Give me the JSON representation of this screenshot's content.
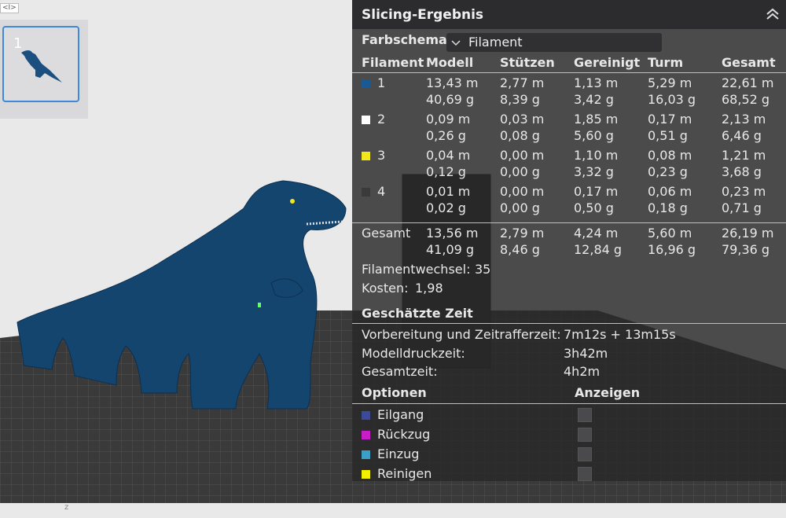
{
  "corner_tag": "<I>",
  "plate": {
    "number": "1"
  },
  "axis_label": "z",
  "panel": {
    "title": "Slicing-Ergebnis",
    "color_scheme": {
      "label": "Farbschema",
      "value": "Filament"
    },
    "table": {
      "headers": [
        "Filament",
        "Modell",
        "Stützen",
        "Gereinigt",
        "Turm",
        "Gesamt"
      ],
      "rows": [
        {
          "id": "1",
          "color": "#1a5a94",
          "m": [
            "13,43 m",
            "2,77 m",
            "1,13 m",
            "5,29 m",
            "22,61 m"
          ],
          "g": [
            "40,69 g",
            "8,39 g",
            "3,42 g",
            "16,03 g",
            "68,52 g"
          ]
        },
        {
          "id": "2",
          "color": "#ffffff",
          "m": [
            "0,09 m",
            "0,03 m",
            "1,85 m",
            "0,17 m",
            "2,13 m"
          ],
          "g": [
            "0,26 g",
            "0,08 g",
            "5,60 g",
            "0,51 g",
            "6,46 g"
          ]
        },
        {
          "id": "3",
          "color": "#f0e81a",
          "m": [
            "0,04 m",
            "0,00 m",
            "1,10 m",
            "0,08 m",
            "1,21 m"
          ],
          "g": [
            "0,12 g",
            "0,00 g",
            "3,32 g",
            "0,23 g",
            "3,68 g"
          ]
        },
        {
          "id": "4",
          "color": "#3a3a3a",
          "m": [
            "0,01 m",
            "0,00 m",
            "0,17 m",
            "0,06 m",
            "0,23 m"
          ],
          "g": [
            "0,02 g",
            "0,00 g",
            "0,50 g",
            "0,18 g",
            "0,71 g"
          ]
        }
      ],
      "total": {
        "label": "Gesamt",
        "m": [
          "13,56 m",
          "2,79 m",
          "4,24 m",
          "5,60 m",
          "26,19 m"
        ],
        "g": [
          "41,09 g",
          "8,46 g",
          "12,84 g",
          "16,96 g",
          "79,36 g"
        ]
      }
    },
    "filament_changes": {
      "label": "Filamentwechsel:",
      "value": "35"
    },
    "cost": {
      "label": "Kosten:",
      "value": "1,98"
    },
    "time": {
      "title": "Geschätzte Zeit",
      "prep_label": "Vorbereitung und Zeitrafferzeit:",
      "prep_value": "7m12s + 13m15s",
      "model_label": "Modelldruckzeit:",
      "model_value": "3h42m",
      "total_label": "Gesamtzeit:",
      "total_value": "4h2m"
    },
    "options": {
      "title": "Optionen",
      "display_title": "Anzeigen",
      "items": [
        {
          "label": "Eilgang",
          "color": "#3c4a9a"
        },
        {
          "label": "Rückzug",
          "color": "#c81ec8"
        },
        {
          "label": "Einzug",
          "color": "#3aa0c8"
        },
        {
          "label": "Reinigen",
          "color": "#f0f000"
        }
      ]
    }
  },
  "colors": {
    "panel_bg": "#2c2c2e",
    "selection": "#3f8ad8",
    "model": "#14456e"
  }
}
